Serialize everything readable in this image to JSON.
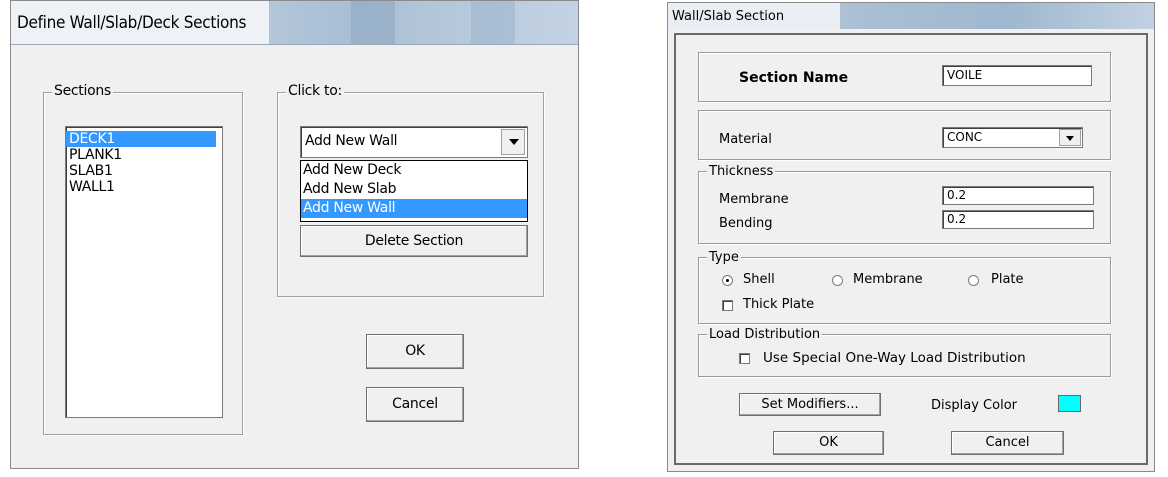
{
  "define_dialog": {
    "title": "Define Wall/Slab/Deck Sections",
    "sections_group_label": "Sections",
    "sections": [
      "DECK1",
      "PLANK1",
      "SLAB1",
      "WALL1"
    ],
    "selected_section": "DECK1",
    "click_to_group_label": "Click to:",
    "combo_value": "Add New Wall",
    "combo_options": [
      "Add New Deck",
      "Add New Slab",
      "Add New Wall"
    ],
    "combo_selected": "Add New Wall",
    "delete_label": "Delete Section",
    "ok_label": "OK",
    "cancel_label": "Cancel"
  },
  "section_dialog": {
    "title": "Wall/Slab Section",
    "section_name_label": "Section Name",
    "section_name_value": "VOILE",
    "material_label": "Material",
    "material_value": "CONC",
    "thickness_label": "Thickness",
    "membrane_label": "Membrane",
    "membrane_value": "0.2",
    "bending_label": "Bending",
    "bending_value": "0.2",
    "type_label": "Type",
    "type_options": [
      "Shell",
      "Membrane",
      "Plate"
    ],
    "type_selected": "Shell",
    "thick_plate_label": "Thick Plate",
    "thick_plate_checked": false,
    "load_dist_label": "Load Distribution",
    "use_special_label": "Use Special One-Way Load Distribution",
    "use_special_checked": false,
    "set_modifiers_label": "Set Modifiers...",
    "display_color_label": "Display Color",
    "display_color": "#00ffff",
    "ok_label": "OK",
    "cancel_label": "Cancel"
  },
  "icons": {
    "combo_arrow": "chevron-down-icon",
    "radio_selected": "radio-selected-icon",
    "radio_unselected": "radio-unselected-icon",
    "checkbox": "checkbox-unchecked-icon"
  },
  "colors": {
    "selection": "#3399ff",
    "dialog_bg": "#f0f0f0",
    "titlebar": "#b7c9dc"
  }
}
